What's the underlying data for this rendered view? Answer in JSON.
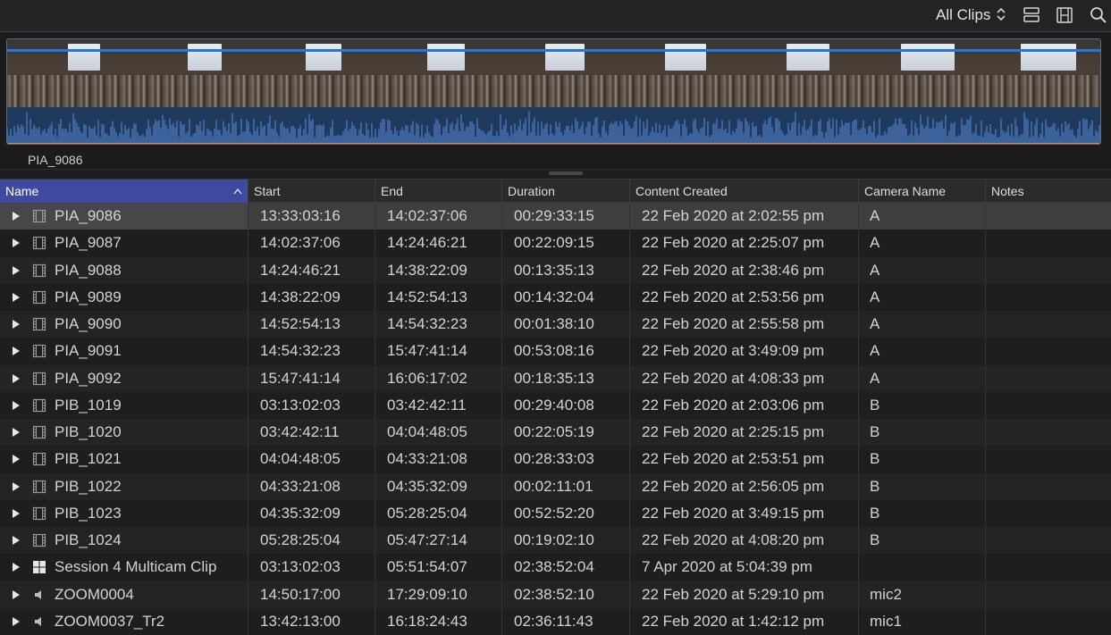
{
  "toolbar": {
    "clips_filter": "All Clips",
    "icons": [
      "updown-chevron-icon",
      "clip-appearance-icon",
      "filmstrip-icon",
      "search-icon"
    ]
  },
  "filmstrip": {
    "clip_name": "PIA_9086",
    "colors": {
      "playhead_line": "#1e78e6",
      "audio_waveform": "#4a74b8",
      "audio_bg": "#1f3a5c",
      "range_bar": "#e08a2e"
    }
  },
  "columns": {
    "name": "Name",
    "start": "Start",
    "end": "End",
    "duration": "Duration",
    "content_created": "Content Created",
    "camera_name": "Camera Name",
    "notes": "Notes"
  },
  "rows": [
    {
      "icon": "video-clip-icon",
      "name": "PIA_9086",
      "start": "13:33:03:16",
      "end": "14:02:37:06",
      "duration": "00:29:33:15",
      "created": "22 Feb 2020 at 2:02:55 pm",
      "camera": "A",
      "notes": ""
    },
    {
      "icon": "video-clip-icon",
      "name": "PIA_9087",
      "start": "14:02:37:06",
      "end": "14:24:46:21",
      "duration": "00:22:09:15",
      "created": "22 Feb 2020 at 2:25:07 pm",
      "camera": "A",
      "notes": ""
    },
    {
      "icon": "video-clip-icon",
      "name": "PIA_9088",
      "start": "14:24:46:21",
      "end": "14:38:22:09",
      "duration": "00:13:35:13",
      "created": "22 Feb 2020 at 2:38:46 pm",
      "camera": "A",
      "notes": ""
    },
    {
      "icon": "video-clip-icon",
      "name": "PIA_9089",
      "start": "14:38:22:09",
      "end": "14:52:54:13",
      "duration": "00:14:32:04",
      "created": "22 Feb 2020 at 2:53:56 pm",
      "camera": "A",
      "notes": ""
    },
    {
      "icon": "video-clip-icon",
      "name": "PIA_9090",
      "start": "14:52:54:13",
      "end": "14:54:32:23",
      "duration": "00:01:38:10",
      "created": "22 Feb 2020 at 2:55:58 pm",
      "camera": "A",
      "notes": ""
    },
    {
      "icon": "video-clip-icon",
      "name": "PIA_9091",
      "start": "14:54:32:23",
      "end": "15:47:41:14",
      "duration": "00:53:08:16",
      "created": "22 Feb 2020 at 3:49:09 pm",
      "camera": "A",
      "notes": ""
    },
    {
      "icon": "video-clip-icon",
      "name": "PIA_9092",
      "start": "15:47:41:14",
      "end": "16:06:17:02",
      "duration": "00:18:35:13",
      "created": "22 Feb 2020 at 4:08:33 pm",
      "camera": "A",
      "notes": ""
    },
    {
      "icon": "video-clip-icon",
      "name": "PIB_1019",
      "start": "03:13:02:03",
      "end": "03:42:42:11",
      "duration": "00:29:40:08",
      "created": "22 Feb 2020 at 2:03:06 pm",
      "camera": "B",
      "notes": ""
    },
    {
      "icon": "video-clip-icon",
      "name": "PIB_1020",
      "start": "03:42:42:11",
      "end": "04:04:48:05",
      "duration": "00:22:05:19",
      "created": "22 Feb 2020 at 2:25:15 pm",
      "camera": "B",
      "notes": ""
    },
    {
      "icon": "video-clip-icon",
      "name": "PIB_1021",
      "start": "04:04:48:05",
      "end": "04:33:21:08",
      "duration": "00:28:33:03",
      "created": "22 Feb 2020 at 2:53:51 pm",
      "camera": "B",
      "notes": ""
    },
    {
      "icon": "video-clip-icon",
      "name": "PIB_1022",
      "start": "04:33:21:08",
      "end": "04:35:32:09",
      "duration": "00:02:11:01",
      "created": "22 Feb 2020 at 2:56:05 pm",
      "camera": "B",
      "notes": ""
    },
    {
      "icon": "video-clip-icon",
      "name": "PIB_1023",
      "start": "04:35:32:09",
      "end": "05:28:25:04",
      "duration": "00:52:52:20",
      "created": "22 Feb 2020 at 3:49:15 pm",
      "camera": "B",
      "notes": ""
    },
    {
      "icon": "video-clip-icon",
      "name": "PIB_1024",
      "start": "05:28:25:04",
      "end": "05:47:27:14",
      "duration": "00:19:02:10",
      "created": "22 Feb 2020 at 4:08:20 pm",
      "camera": "B",
      "notes": ""
    },
    {
      "icon": "multicam-clip-icon",
      "name": "Session 4 Multicam Clip",
      "start": "03:13:02:03",
      "end": "05:51:54:07",
      "duration": "02:38:52:04",
      "created": "7 Apr 2020 at 5:04:39 pm",
      "camera": "",
      "notes": ""
    },
    {
      "icon": "audio-clip-icon",
      "name": "ZOOM0004",
      "start": "14:50:17:00",
      "end": "17:29:09:10",
      "duration": "02:38:52:10",
      "created": "22 Feb 2020 at 5:29:10 pm",
      "camera": "mic2",
      "notes": ""
    },
    {
      "icon": "audio-clip-icon",
      "name": "ZOOM0037_Tr2",
      "start": "13:42:13:00",
      "end": "16:18:24:43",
      "duration": "02:36:11:43",
      "created": "22 Feb 2020 at 1:42:12 pm",
      "camera": "mic1",
      "notes": ""
    }
  ]
}
